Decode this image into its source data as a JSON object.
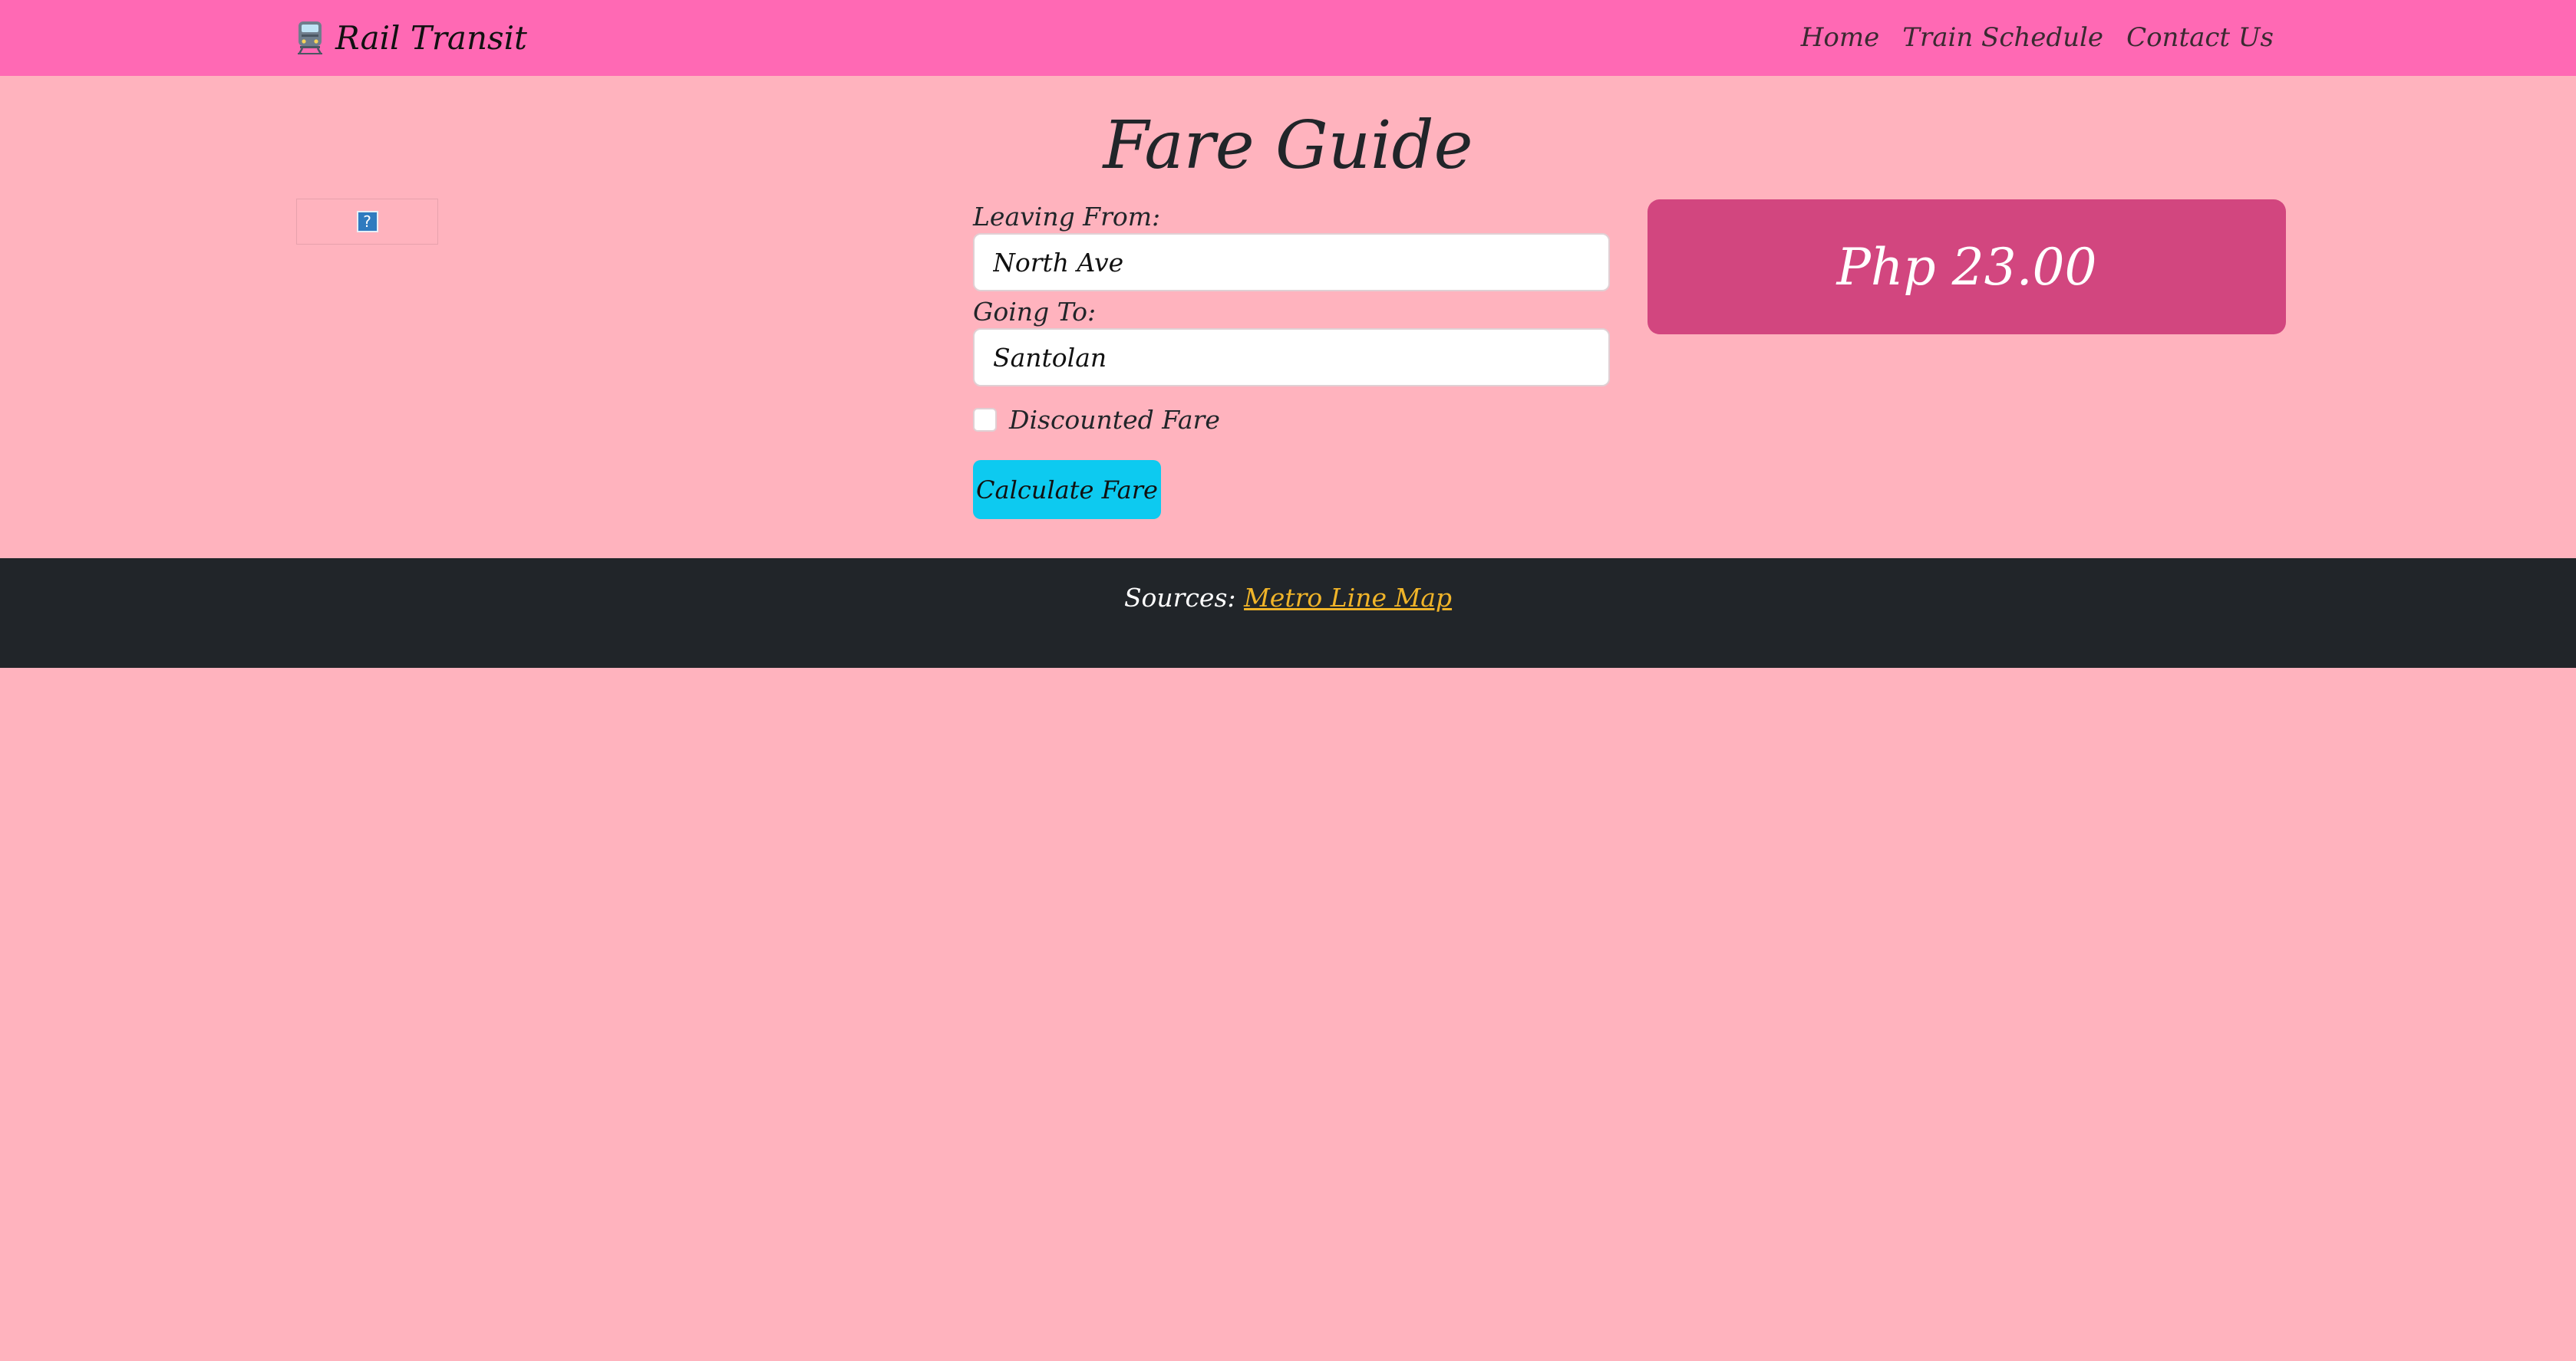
{
  "navbar": {
    "brand_icon": "train-icon",
    "brand_text": "Rail Transit",
    "links": [
      "Home",
      "Train Schedule",
      "Contact Us"
    ]
  },
  "main": {
    "title": "Fare Guide",
    "map_image": "broken-image-icon",
    "form": {
      "from_label": "Leaving From:",
      "from_value": "North Ave",
      "to_label": "Going To:",
      "to_value": "Santolan",
      "discount_label": "Discounted Fare",
      "discount_checked": false,
      "submit_label": "Calculate Fare"
    },
    "fare": {
      "amount": "Php 23.00"
    }
  },
  "footer": {
    "sources_label": "Sources:",
    "sources_link": "Metro Line Map"
  },
  "colors": {
    "navbar_bg": "#ff69b4",
    "page_bg": "#ffb3be",
    "fare_box_bg": "#d2467f",
    "button_bg": "#0dcaf0",
    "footer_bg": "#212529",
    "link_color": "#f0b429"
  }
}
